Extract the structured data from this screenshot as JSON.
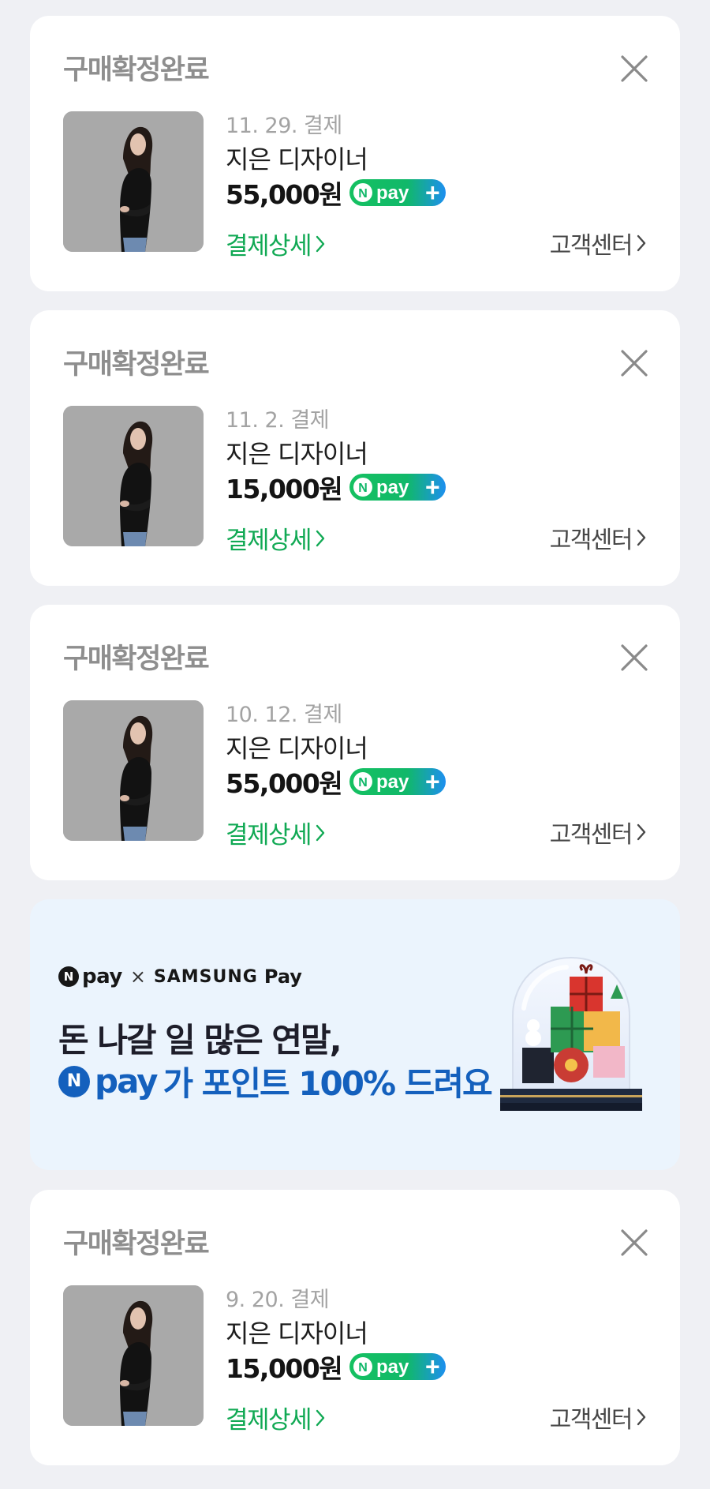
{
  "orders": [
    {
      "status": "구매확정완료",
      "date": "11. 29. 결제",
      "product": "지은 디자이너",
      "price": "55,000원",
      "detail_label": "결제상세",
      "cs_label": "고객센터"
    },
    {
      "status": "구매확정완료",
      "date": "11. 2. 결제",
      "product": "지은 디자이너",
      "price": "15,000원",
      "detail_label": "결제상세",
      "cs_label": "고객센터"
    },
    {
      "status": "구매확정완료",
      "date": "10. 12. 결제",
      "product": "지은 디자이너",
      "price": "55,000원",
      "detail_label": "결제상세",
      "cs_label": "고객센터"
    },
    {
      "status": "구매확정완료",
      "date": "9. 20. 결제",
      "product": "지은 디자이너",
      "price": "15,000원",
      "detail_label": "결제상세",
      "cs_label": "고객센터"
    }
  ],
  "npay_badge": {
    "n": "N",
    "pay": "pay",
    "plus": "+"
  },
  "banner": {
    "brand_n": "N",
    "brand_pay": "pay",
    "brand_x": "×",
    "brand_samsung": "SAMSUNG",
    "brand_samsung_pay": "Pay",
    "line1": "돈 나갈 일 많은 연말,",
    "line2_n": "N",
    "line2_pay": "pay",
    "line2_rest": "가 포인트 100% 드려요"
  },
  "colors": {
    "page_bg": "#eff0f4",
    "card_bg": "#ffffff",
    "accent_green": "#11a954",
    "banner_bg": "#ebf4fd",
    "banner_blue": "#1460bd"
  },
  "icons": {
    "close": "close-icon",
    "chevron": "chevron-right-icon",
    "thumbnail": "product-thumbnail",
    "banner_art": "gift-snow-globe-illustration"
  }
}
